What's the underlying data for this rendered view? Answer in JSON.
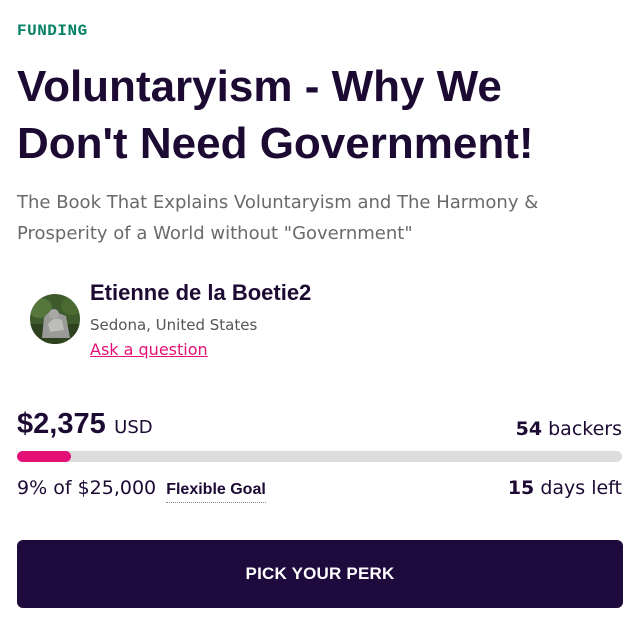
{
  "campaign": {
    "status_tag": "FUNDING",
    "title": "Voluntaryism - Why We Don't Need Government!",
    "subtitle": "The Book That Explains Voluntaryism and The Harmony & Prosperity of a World without \"Government\""
  },
  "owner": {
    "name": "Etienne de la Boetie2",
    "location": "Sedona, United States",
    "ask_link": "Ask a question",
    "avatar_icon": "owner-avatar-photo"
  },
  "funding": {
    "raised_amount": "$2,375",
    "currency": "USD",
    "backers_count": "54",
    "backers_label": "backers",
    "percent_funded": 0.09,
    "percent_text": "9%",
    "goal_prefix": "of",
    "goal_amount": "$25,000",
    "goal_type": "Flexible Goal",
    "days_count": "15",
    "days_label": "days left"
  },
  "cta": {
    "label": "PICK YOUR PERK"
  },
  "colors": {
    "accent": "#e51075",
    "status_green": "#088366",
    "primary_dark": "#1e0a3c",
    "track": "#dddddd"
  }
}
